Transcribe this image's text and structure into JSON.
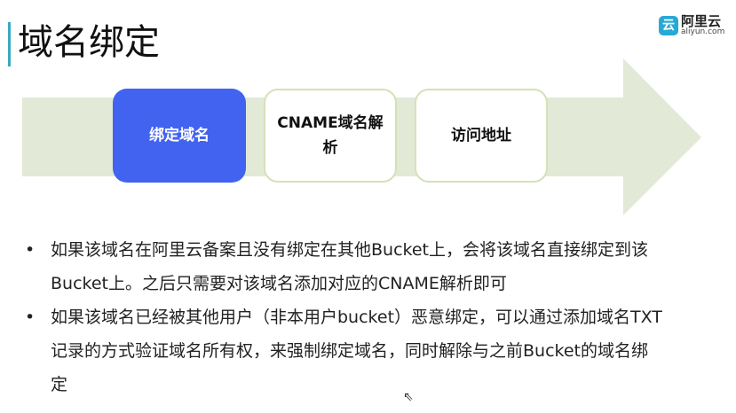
{
  "title": "域名绑定",
  "logo": {
    "cn": "阿里云",
    "en": "aliyun.com"
  },
  "steps": [
    "绑定域名",
    "CNAME域名解析",
    "访问地址"
  ],
  "bullets": [
    "如果该域名在阿里云备案且没有绑定在其他Bucket上，会将该域名直接绑定到该Bucket上。之后只需要对该域名添加对应的CNAME解析即可",
    "如果该域名已经被其他用户（非本用户bucket）恶意绑定，可以通过添加域名TXT记录的方式验证域名所有权，来强制绑定域名，同时解除与之前Bucket的域名绑定"
  ],
  "colors": {
    "accent": "#3aa9c0",
    "active_step": "#4263f0",
    "arrow": "#e2e9d7"
  }
}
